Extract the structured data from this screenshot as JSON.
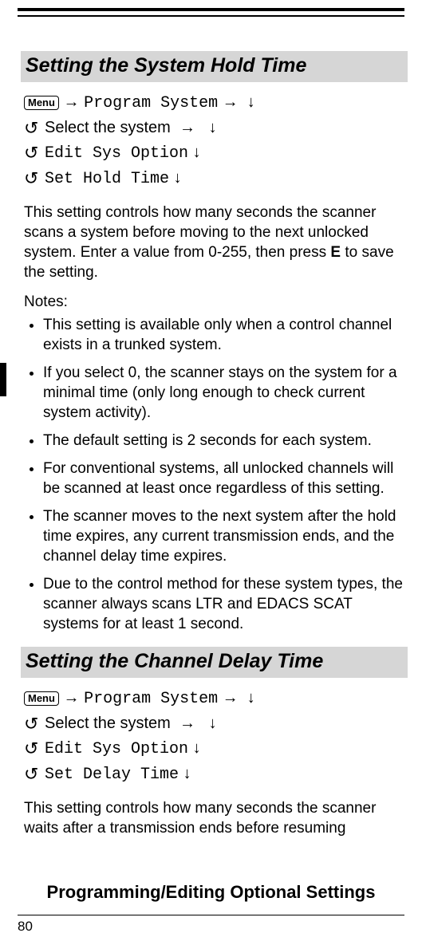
{
  "page_number": "80",
  "footer_title": "Programming/Editing Optional Settings",
  "section1": {
    "heading": "Setting the System Hold Time",
    "menu_key": "Menu",
    "nav_line1_mono": "Program System",
    "nav_select": "Select the system",
    "nav_line3_mono": "Edit Sys Option",
    "nav_line4_mono": "Set Hold Time",
    "paragraph_pre": "This setting controls how many seconds the scanner scans a system before moving to the next unlocked system. Enter a value from 0-255, then press ",
    "paragraph_bold": "E",
    "paragraph_post": " to save the setting.",
    "notes_label": "Notes:",
    "notes": [
      "This setting is available only when a control channel exists in a trunked system.",
      "If you select 0, the scanner stays on the system for a minimal time (only long enough to check current system activity).",
      "The default setting is 2 seconds for each system.",
      "For conventional systems, all unlocked channels will be scanned at least once regardless of this setting.",
      "The scanner moves to the next system after the hold time expires, any current transmission ends, and the channel delay time expires.",
      "Due to the control method for these system types, the scanner always scans LTR and EDACS SCAT systems for at least 1 second."
    ]
  },
  "section2": {
    "heading": "Setting the Channel Delay Time",
    "menu_key": "Menu",
    "nav_line1_mono": "Program System",
    "nav_select": "Select the system",
    "nav_line3_mono": "Edit Sys Option",
    "nav_line4_mono": "Set Delay Time",
    "paragraph": "This setting controls how many seconds the scanner waits after a transmission ends before resuming"
  },
  "glyphs": {
    "rarr": "→",
    "darr": "↓",
    "rotate": "↺"
  }
}
